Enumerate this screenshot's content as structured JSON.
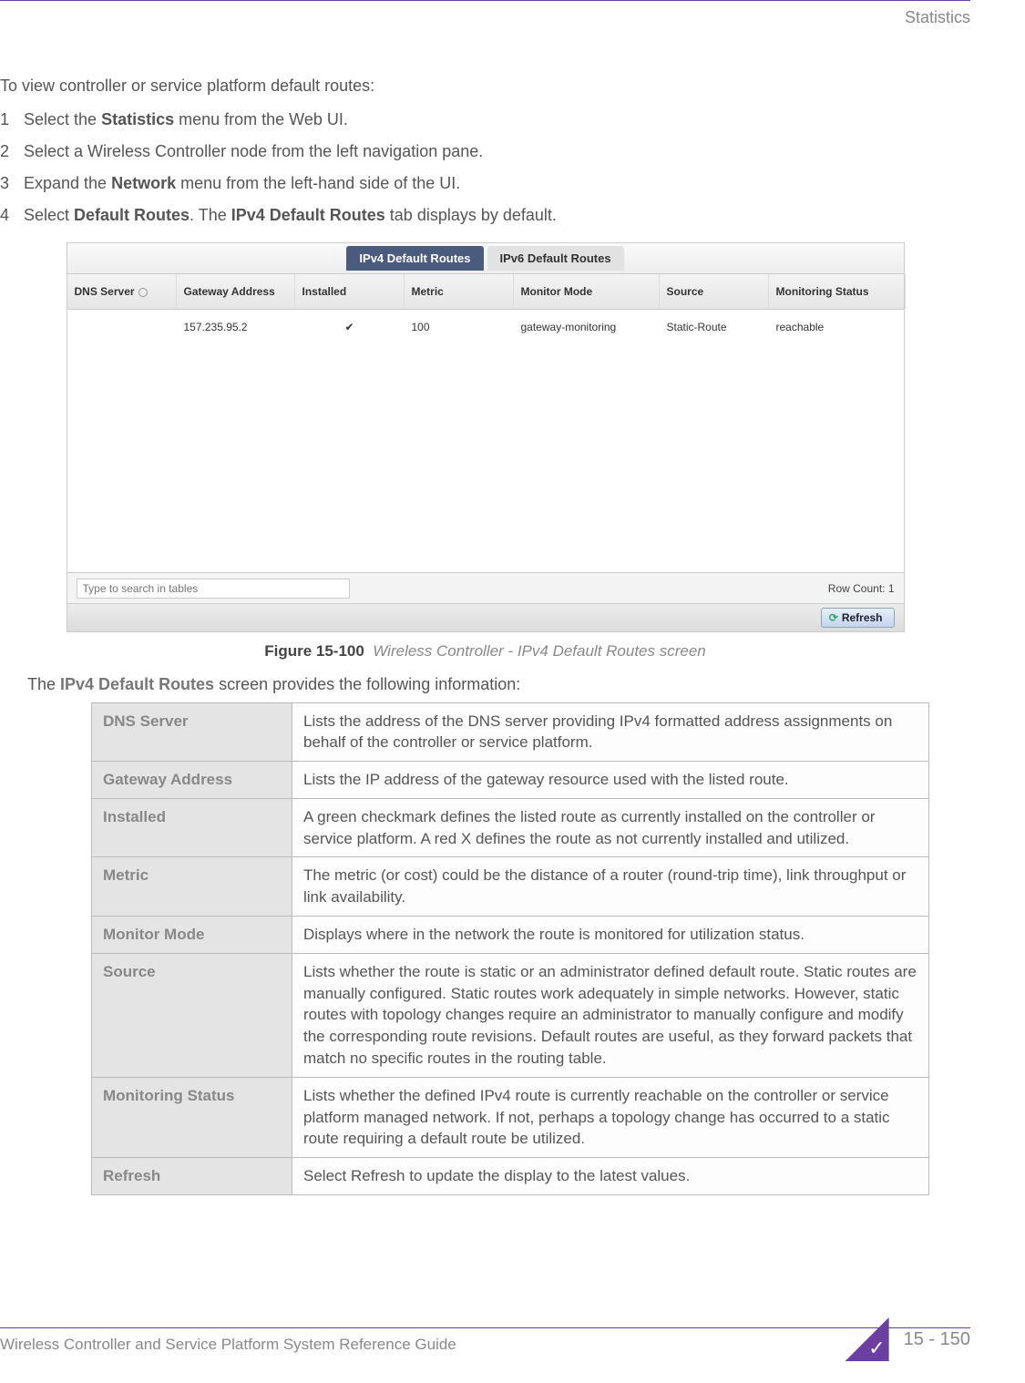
{
  "header": {
    "section": "Statistics"
  },
  "intro": "To view controller or service platform default routes:",
  "steps": [
    {
      "num": "1",
      "pre": "Select the ",
      "bold": "Statistics",
      "post": " menu from the Web UI."
    },
    {
      "num": "2",
      "pre": "Select a Wireless Controller node from the left navigation pane.",
      "bold": "",
      "post": ""
    },
    {
      "num": "3",
      "pre": "Expand the ",
      "bold": "Network",
      "post": " menu from the left-hand side of the UI."
    },
    {
      "num": "4",
      "pre": "Select ",
      "bold": "Default Routes",
      "post": ". The ",
      "bold2": "IPv4 Default Routes",
      "post2": " tab displays by default."
    }
  ],
  "screenshot": {
    "tabs": {
      "active": "IPv4 Default Routes",
      "inactive": "IPv6 Default Routes"
    },
    "headers": [
      "DNS Server",
      "Gateway Address",
      "Installed",
      "Metric",
      "Monitor Mode",
      "Source",
      "Monitoring Status"
    ],
    "row": {
      "dns": "",
      "gateway": "157.235.95.2",
      "installed": "✔",
      "metric": "100",
      "monitor": "gateway-monitoring",
      "source": "Static-Route",
      "status": "reachable"
    },
    "search_placeholder": "Type to search in tables",
    "rowcount": "Row Count:   1",
    "refresh": "Refresh"
  },
  "figure": {
    "label": "Figure 15-100",
    "caption": "Wireless Controller - IPv4 Default Routes screen"
  },
  "pre_table": {
    "pre": "The ",
    "bold": "IPv4 Default Routes",
    "post": " screen provides the following information:"
  },
  "desc": [
    {
      "k": "DNS Server",
      "v": "Lists the address of the DNS server providing IPv4 formatted address assignments on behalf of the controller or service platform."
    },
    {
      "k": "Gateway Address",
      "v": "Lists the IP address of the gateway resource used with the listed route."
    },
    {
      "k": "Installed",
      "v": "A green checkmark defines the listed route as currently installed on the controller or service platform. A red X defines the route as not currently installed and utilized."
    },
    {
      "k": "Metric",
      "v": "The metric (or cost) could be the distance of a router (round-trip time), link throughput or link availability."
    },
    {
      "k": "Monitor Mode",
      "v": "Displays where in the network the route is monitored for utilization status."
    },
    {
      "k": "Source",
      "v": "Lists whether the route is static or an administrator defined default route. Static routes are manually configured. Static routes work adequately in simple networks. However, static routes with topology changes require an administrator to manually configure and modify the corresponding route revisions. Default routes are useful, as they forward packets that match no specific routes in the routing table."
    },
    {
      "k": "Monitoring Status",
      "v": "Lists whether the defined IPv4 route is currently reachable on the controller or service platform managed network. If not, perhaps a topology change has occurred to a static route requiring a default route be utilized."
    },
    {
      "k": "Refresh",
      "v": "Select Refresh to update the display to the latest values."
    }
  ],
  "footer": {
    "left": "Wireless Controller and Service Platform System Reference Guide",
    "right": "15 - 150"
  }
}
